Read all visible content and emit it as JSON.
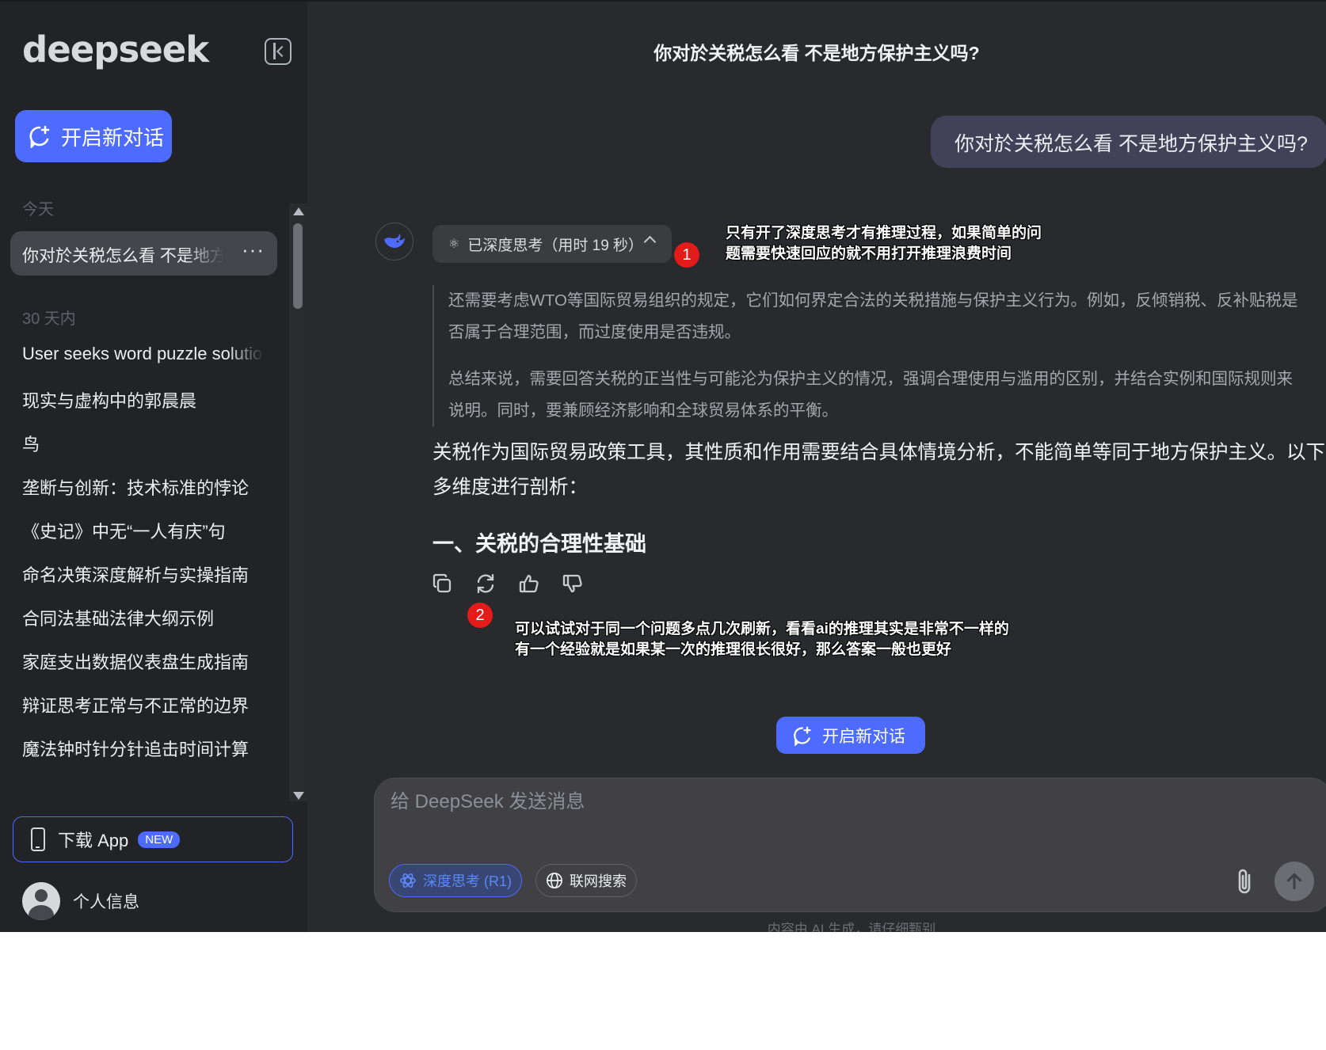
{
  "sidebar": {
    "logo": "deepseek",
    "new_chat_label": "开启新对话",
    "section_today": "今天",
    "active_chat": "你对於关税怎么看 不是地方保护主义吗?",
    "active_more": "···",
    "section_30days": "30 天内",
    "items": [
      "User seeks word puzzle solution",
      "现实与虚构中的郭晨晨",
      "鸟",
      "垄断与创新：技术标准的悖论",
      "《史记》中无“一人有庆”句",
      "命名决策深度解析与实操指南",
      "合同法基础法律大纲示例",
      "家庭支出数据仪表盘生成指南",
      "辩证思考正常与不正常的边界",
      "魔法钟时针分针追击时间计算"
    ],
    "download_label": "下载 App",
    "download_badge": "NEW",
    "profile_label": "个人信息"
  },
  "main": {
    "title": "你对於关税怎么看 不是地方保护主义吗?",
    "user_message": "你对於关税怎么看 不是地方保护主义吗?",
    "think_label": "已深度思考（用时 19 秒）",
    "reasoning": [
      "还需要考虑WTO等国际贸易组织的规定，它们如何界定合法的关税措施与保护主义行为。例如，反倾销税、反补贴税是",
      "否属于合理范围，而过度使用是否违规。",
      "总结来说，需要回答关税的正当性与可能沦为保护主义的情况，强调合理使用与滥用的区别，并结合实例和国际规则来",
      "说明。同时，要兼顾经济影响和全球贸易体系的平衡。"
    ],
    "answer_lines": [
      "关税作为国际贸易政策工具，其性质和作用需要结合具体情境分析，不能简单等同于地方保护主义。以下从",
      "多维度进行剖析："
    ],
    "answer_heading": "一、关税的合理性基础",
    "new_chat_label": "开启新对话",
    "composer_placeholder": "给 DeepSeek 发送消息",
    "deep_think_label": "深度思考 (R1)",
    "web_search_label": "联网搜索",
    "disclaimer": "内容由 AI 生成，请仔细甄别"
  },
  "annotations": [
    {
      "num": "1",
      "lines": [
        "只有开了深度思考才有推理过程，如果简单的问",
        "题需要快速回应的就不用打开推理浪费时间"
      ]
    },
    {
      "num": "2",
      "lines": [
        "可以试试对于同一个问题多点几次刷新，看看ai的推理其实是非常不一样的",
        "有一个经验就是如果某一次的推理很长很好，那么答案一般也更好"
      ]
    }
  ],
  "colors": {
    "accent": "#4d6bfe",
    "sidebar_bg": "#212327",
    "main_bg": "#292a2d",
    "annotation_red": "#e31b1b"
  },
  "icons": {
    "collapse": "sidebar-collapse-icon",
    "new_chat": "chat-plus-icon",
    "more": "ellipsis-icon",
    "phone": "phone-icon",
    "avatar": "user-avatar-icon",
    "deepseek": "deepseek-whale-icon",
    "atom": "atom-icon",
    "chevron": "chevron-up-icon",
    "copy": "copy-icon",
    "refresh": "refresh-icon",
    "thumbs_up": "thumbs-up-icon",
    "thumbs_down": "thumbs-down-icon",
    "globe": "globe-icon",
    "attach": "paperclip-icon",
    "send": "arrow-up-icon"
  }
}
